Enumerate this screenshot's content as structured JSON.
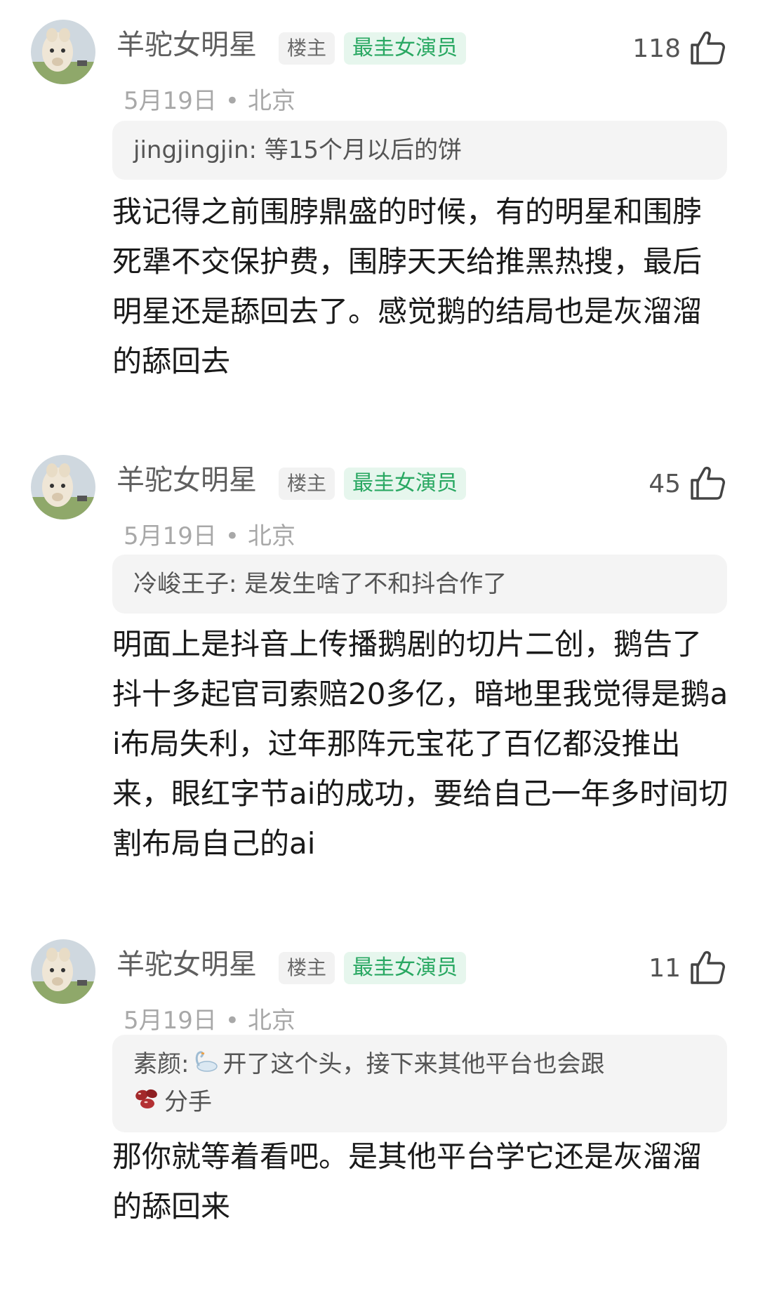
{
  "comments": [
    {
      "author": "羊驼女明星",
      "op_badge": "楼主",
      "title_badge": "最圭女演员",
      "likes": "118",
      "date": "5月19日",
      "location": "北京",
      "quote_author": "jingjingjin:",
      "quote_text": "等15个月以后的饼",
      "body": "我记得之前围脖鼎盛的时候，有的明星和围脖死犟不交保护费，围脖天天给推黑热搜，最后明星还是舔回去了。感觉鹅的结局也是灰溜溜的舔回去"
    },
    {
      "author": "羊驼女明星",
      "op_badge": "楼主",
      "title_badge": "最圭女演员",
      "likes": "45",
      "date": "5月19日",
      "location": "北京",
      "quote_author": "冷峻王子:",
      "quote_text": "是发生啥了不和抖合作了",
      "body": "明面上是抖音上传播鹅剧的切片二创，鹅告了抖十多起官司索赔20多亿，暗地里我觉得是鹅ai布局失利，过年那阵元宝花了百亿都没推出来，眼红字节ai的成功，要给自己一年多时间切割布局自己的ai"
    },
    {
      "author": "羊驼女明星",
      "op_badge": "楼主",
      "title_badge": "最圭女演员",
      "likes": "11",
      "date": "5月19日",
      "location": "北京",
      "quote_author": "素颜:",
      "quote_text_1": "开了这个头，接下来其他平台也会跟",
      "quote_text_2": "分手",
      "body": "那你就等着看吧。是其他平台学它还是灰溜溜的舔回来"
    }
  ],
  "icons": {
    "avatar": "alpaca-avatar-icon",
    "like": "thumbs-up-icon",
    "quote_emoji_1": "swan-emoji-icon",
    "quote_emoji_2": "beans-emoji-icon"
  },
  "colors": {
    "title_badge_text": "#29a862",
    "title_badge_bg": "#e6f6ed",
    "quote_bg": "#f4f4f4"
  }
}
